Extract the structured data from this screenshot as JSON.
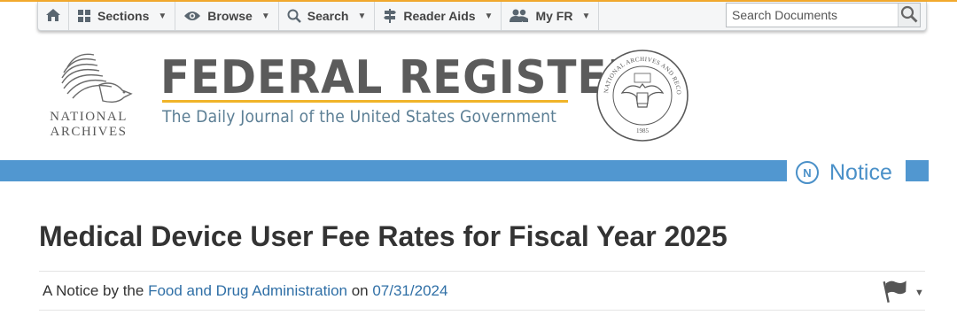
{
  "nav": {
    "items": [
      {
        "label": "Sections",
        "icon": "grid-icon"
      },
      {
        "label": "Browse",
        "icon": "eye-icon"
      },
      {
        "label": "Search",
        "icon": "search-icon"
      },
      {
        "label": "Reader Aids",
        "icon": "signpost-icon"
      },
      {
        "label": "My FR",
        "icon": "users-icon"
      }
    ],
    "search_placeholder": "Search Documents"
  },
  "masthead": {
    "archives_line1": "NATIONAL",
    "archives_line2": "ARCHIVES",
    "title": "FEDERAL REGISTER",
    "tagline": "The Daily Journal of the United States Government",
    "seal_top_text": "NATIONAL ARCHIVES AND RECORDS ADMINISTRATION",
    "seal_year": "1985"
  },
  "notice": {
    "badge_letter": "N",
    "label": "Notice"
  },
  "document": {
    "title": "Medical Device User Fee Rates for Fiscal Year 2025",
    "meta_prefix": "A Notice by the ",
    "agency": "Food and Drug Administration",
    "meta_on": " on ",
    "date": "07/31/2024"
  },
  "colors": {
    "accent_blue": "#5197d0",
    "gold": "#f0b429",
    "link": "#2f6fa6"
  }
}
